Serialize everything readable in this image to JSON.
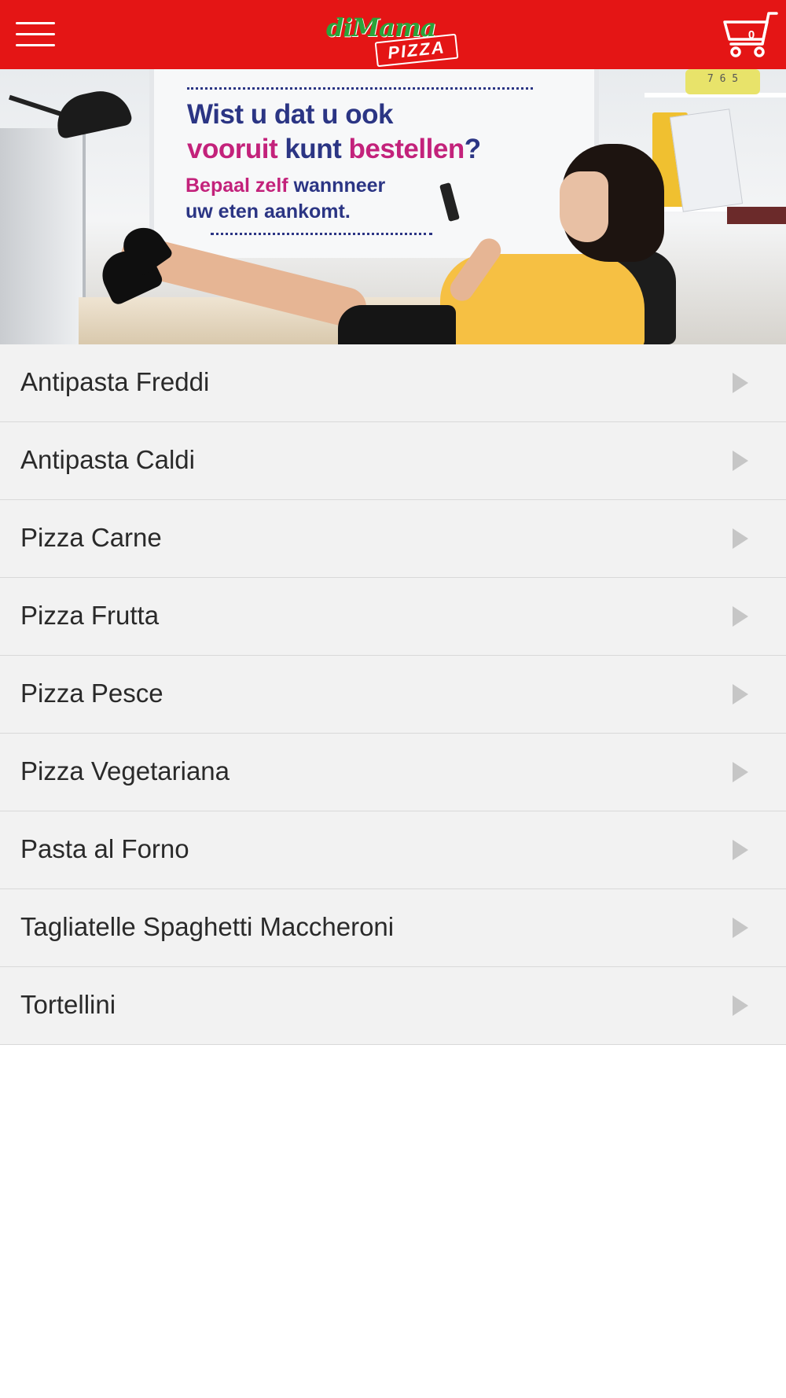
{
  "header": {
    "menu_icon": "hamburger-menu-icon",
    "logo": {
      "script_text": "diMama",
      "tag_text": "PIZZA",
      "brand_color": "#2aa33a"
    },
    "cart": {
      "icon": "shopping-cart-icon",
      "count": "0"
    },
    "background_color": "#e41515"
  },
  "banner": {
    "headline_line1": "Wist u dat u ook",
    "headline_word1": "vooruit",
    "headline_word2": "kunt",
    "headline_word3": "bestellen",
    "headline_mark": "?",
    "sub_pink": "Bepaal zelf",
    "sub_rest": "wannneer",
    "sub_line2": "uw eten aankomt.",
    "clock_digits": "7 6 5",
    "colors": {
      "navy": "#2b3584",
      "pink": "#c3227b"
    }
  },
  "categories": [
    {
      "label": "Antipasta Freddi"
    },
    {
      "label": "Antipasta Caldi"
    },
    {
      "label": "Pizza Carne"
    },
    {
      "label": "Pizza Frutta"
    },
    {
      "label": "Pizza Pesce"
    },
    {
      "label": "Pizza Vegetariana"
    },
    {
      "label": "Pasta al Forno"
    },
    {
      "label": "Tagliatelle Spaghetti Maccheroni"
    },
    {
      "label": "Tortellini"
    }
  ],
  "chevron_icon": "chevron-right-icon"
}
